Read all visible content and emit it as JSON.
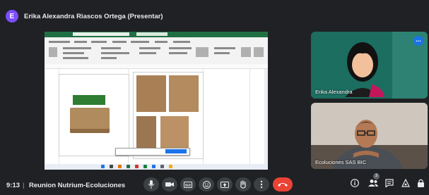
{
  "presenter": {
    "initial": "E",
    "label": "Erika Alexandra Riascos Ortega (Presentar)"
  },
  "participants": [
    {
      "name": "Erika Alexandra",
      "more_label": "..."
    },
    {
      "name": "Ecoluciones SAS BIC"
    }
  ],
  "meeting": {
    "time": "9:13",
    "separator": "|",
    "title": "Reunion Nutrium-Ecoluciones",
    "people_count": "3"
  },
  "controls": {
    "mic_icon": "microphone-icon",
    "camera_icon": "camera-icon",
    "captions_icon": "captions-icon",
    "emoji_icon": "emoji-icon",
    "present_icon": "present-screen-icon",
    "hand_icon": "raise-hand-icon",
    "more_icon": "more-options-icon",
    "end_icon": "end-call-icon"
  },
  "colors": {
    "background": "#202124",
    "end_call": "#ea4335",
    "accent": "#1a73e8",
    "excel_green": "#1f6f43"
  }
}
